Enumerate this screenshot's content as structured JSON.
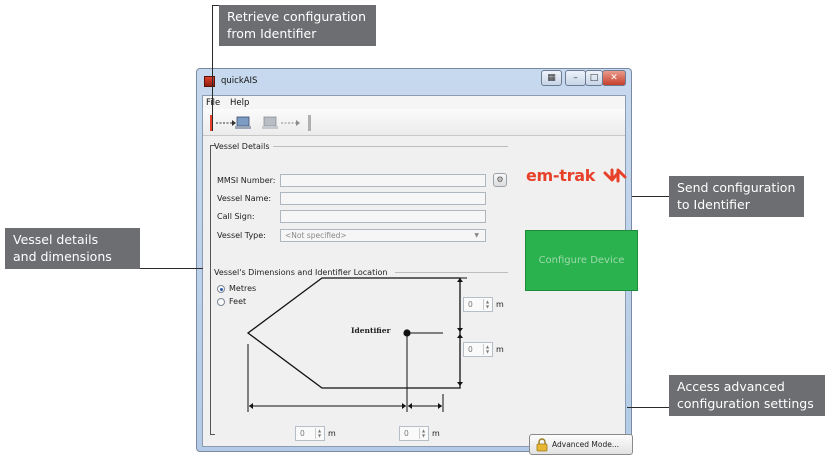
{
  "callouts": {
    "retrieve": [
      "Retrieve configuration",
      "from Identifier"
    ],
    "send": [
      "Send configuration",
      "to Identifier"
    ],
    "vessel": [
      "Vessel details",
      "and dimensions"
    ],
    "advanced": [
      "Access advanced",
      "configuration settings"
    ]
  },
  "window": {
    "title": "quickAIS",
    "menu": [
      "File",
      "Help"
    ]
  },
  "vessel_details": {
    "section_title": "Vessel Details",
    "mmsi_label": "MMSI Number:",
    "mmsi_value": "",
    "name_label": "Vessel Name:",
    "name_value": "",
    "callsign_label": "Call Sign:",
    "callsign_value": "",
    "type_label": "Vessel Type:",
    "type_value": "<Not specified>"
  },
  "dimensions": {
    "section_title": "Vessel's Dimensions and Identifier Location",
    "unit_options": [
      "Metres",
      "Feet"
    ],
    "selected_unit": "Metres",
    "identifier_label": "Identifier",
    "spin_values": {
      "top": "0",
      "right": "0",
      "bottom_left": "0",
      "bottom_right": "0"
    },
    "unit_suffix": "m"
  },
  "brand": {
    "logo_text": "em-trak",
    "accent": "#e8412a"
  },
  "actions": {
    "configure_label": "Configure Device",
    "advanced_label": "Advanced Mode..."
  },
  "colors": {
    "callout_bg": "#6d6e71",
    "configure_green": "#29b24e"
  }
}
